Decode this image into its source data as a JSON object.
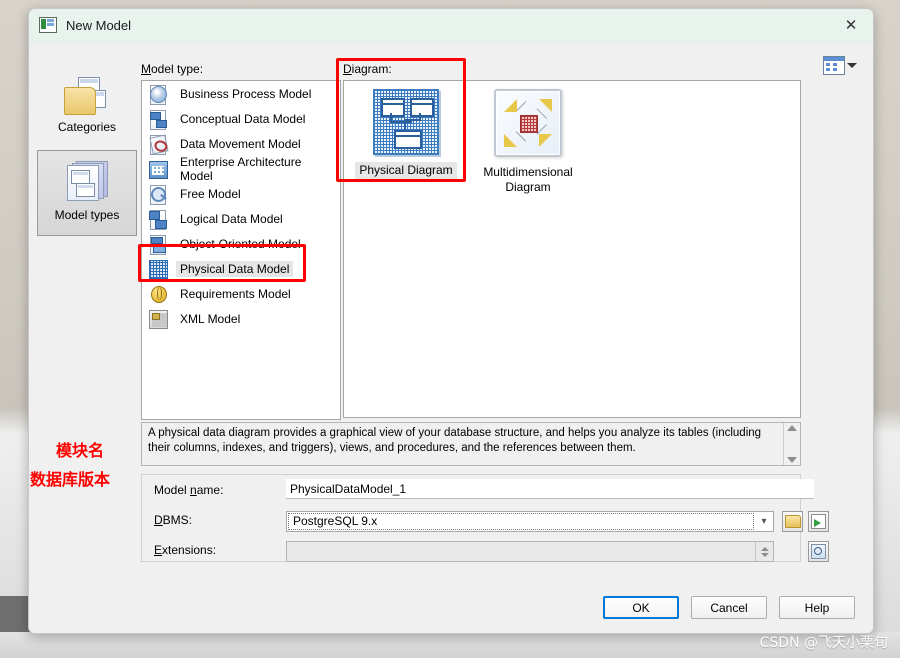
{
  "window": {
    "title": "New Model",
    "app_icon": "model-document-icon",
    "close_label": "✕"
  },
  "sidebar": {
    "items": [
      {
        "label": "Categories",
        "icon": "folder-pages-icon",
        "selected": false
      },
      {
        "label": "Model types",
        "icon": "stacked-pages-icon",
        "selected": true
      }
    ]
  },
  "model_type": {
    "label": "Model type:",
    "label_accel": "M",
    "items": [
      {
        "label": "Business Process Model",
        "icon": "business-process-icon",
        "selected": false
      },
      {
        "label": "Conceptual Data Model",
        "icon": "conceptual-data-icon",
        "selected": false
      },
      {
        "label": "Data Movement Model",
        "icon": "data-movement-icon",
        "selected": false
      },
      {
        "label": "Enterprise Architecture Model",
        "icon": "enterprise-architecture-icon",
        "selected": false
      },
      {
        "label": "Free Model",
        "icon": "free-model-icon",
        "selected": false
      },
      {
        "label": "Logical Data Model",
        "icon": "logical-data-icon",
        "selected": false
      },
      {
        "label": "Object-Oriented Model",
        "icon": "object-oriented-icon",
        "selected": false
      },
      {
        "label": "Physical Data Model",
        "icon": "physical-data-icon",
        "selected": true
      },
      {
        "label": "Requirements Model",
        "icon": "requirements-icon",
        "selected": false
      },
      {
        "label": "XML Model",
        "icon": "xml-model-icon",
        "selected": false
      }
    ]
  },
  "diagram": {
    "label": "Diagram:",
    "items": [
      {
        "label": "Physical Diagram",
        "icon": "physical-diagram-thumb",
        "selected": true
      },
      {
        "label": "Multidimensional Diagram",
        "icon": "multidimensional-diagram-thumb",
        "selected": false
      }
    ],
    "view_mode_icon": "list-view-icon",
    "view_mode_arrow": "chevron-down-icon"
  },
  "description": {
    "text": "A physical data diagram provides a graphical view of your database structure, and helps you analyze its tables (including their columns, indexes, and triggers), views, and procedures, and the references between them."
  },
  "form": {
    "model_name": {
      "label": "Model name:",
      "accel": "n",
      "value": "PhysicalDataModel_1",
      "placeholder": ""
    },
    "dbms": {
      "label": "DBMS:",
      "accel": "D",
      "value": "PostgreSQL 9.x",
      "arrow": "⌄",
      "buttons": [
        {
          "name": "browse-dbms-button",
          "icon": "folder-icon"
        },
        {
          "name": "import-dbms-button",
          "icon": "green-arrow-import-icon"
        }
      ]
    },
    "extensions": {
      "label": "Extensions:",
      "accel": "E",
      "value": "",
      "buttons": [
        {
          "name": "preview-extensions-button",
          "icon": "magnifier-preview-icon"
        }
      ]
    }
  },
  "buttons": {
    "ok": "OK",
    "cancel": "Cancel",
    "help": "Help"
  },
  "annotations": {
    "note_module_name": "模块名",
    "note_db_version": "数据库版本",
    "highlight_color": "#ff0000"
  },
  "watermark": {
    "text": "CSDN @飞天小栗旬"
  },
  "colors": {
    "titlebar": "#e9f3ee",
    "dialog_bg": "#f0f0f0",
    "accent_blue": "#0078d7",
    "annotation_red": "#ff0000",
    "selection_gray": "#e6e6e6"
  }
}
